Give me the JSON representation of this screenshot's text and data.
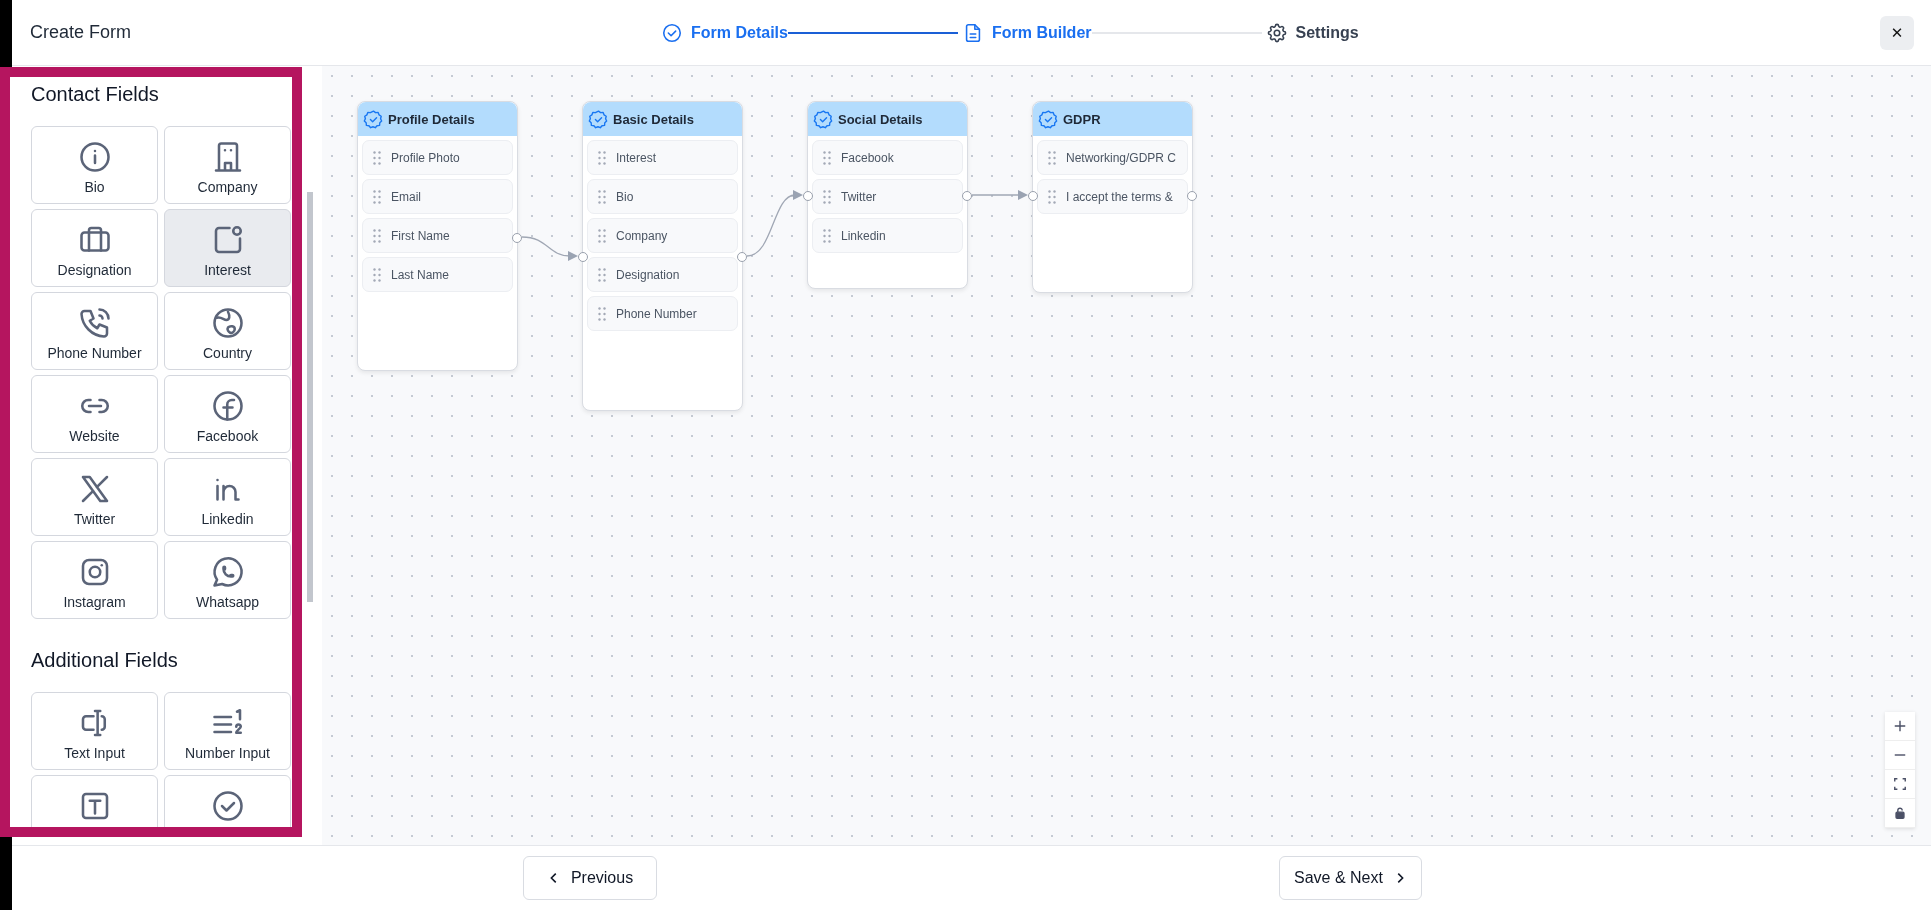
{
  "header": {
    "title": "Create Form",
    "close": "✕"
  },
  "steps": [
    {
      "label": "Form Details",
      "kind": "check",
      "active": true
    },
    {
      "label": "Form Builder",
      "kind": "document",
      "active": true
    },
    {
      "label": "Settings",
      "kind": "gear",
      "active": false
    }
  ],
  "sidebar": {
    "sections": [
      {
        "heading": "Contact Fields",
        "tiles": [
          {
            "label": "Bio",
            "kind": "info",
            "selected": false
          },
          {
            "label": "Company",
            "kind": "building",
            "selected": false
          },
          {
            "label": "Designation",
            "kind": "briefcase",
            "selected": false
          },
          {
            "label": "Interest",
            "kind": "note",
            "selected": true
          },
          {
            "label": "Phone Number",
            "kind": "phone",
            "selected": false
          },
          {
            "label": "Country",
            "kind": "globe",
            "selected": false
          },
          {
            "label": "Website",
            "kind": "link",
            "selected": false
          },
          {
            "label": "Facebook",
            "kind": "facebook",
            "selected": false
          },
          {
            "label": "Twitter",
            "kind": "x",
            "selected": false
          },
          {
            "label": "Linkedin",
            "kind": "linkedin",
            "selected": false
          },
          {
            "label": "Instagram",
            "kind": "instagram",
            "selected": false
          },
          {
            "label": "Whatsapp",
            "kind": "whatsapp",
            "selected": false
          }
        ]
      },
      {
        "heading": "Additional Fields",
        "tiles": [
          {
            "label": "Text Input",
            "kind": "textinput",
            "selected": false
          },
          {
            "label": "Number Input",
            "kind": "numbers",
            "selected": false
          },
          {
            "kind": "textbox",
            "selected": false
          },
          {
            "kind": "check",
            "selected": false
          }
        ]
      }
    ]
  },
  "canvas": {
    "nodes": [
      {
        "title": "Profile Details",
        "fields": [
          "Profile Photo",
          "Email",
          "First Name",
          "Last Name"
        ]
      },
      {
        "title": "Basic Details",
        "fields": [
          "Interest",
          "Bio",
          "Company",
          "Designation",
          "Phone Number"
        ]
      },
      {
        "title": "Social Details",
        "fields": [
          "Facebook",
          "Twitter",
          "Linkedin"
        ]
      },
      {
        "title": "GDPR",
        "fields": [
          "Networking/GDPR C",
          "I accept the terms &"
        ]
      }
    ]
  },
  "footer": {
    "previous": "Previous",
    "next": "Save & Next"
  }
}
